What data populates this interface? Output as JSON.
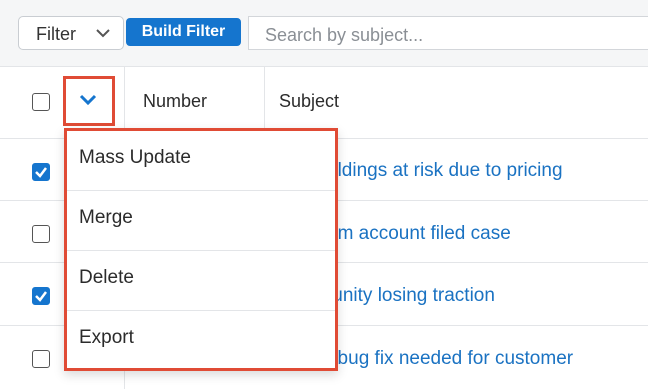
{
  "filter": {
    "label": "Filter",
    "build_filter_label": "Build Filter",
    "search_placeholder": "Search by subject..."
  },
  "table": {
    "columns": [
      "Number",
      "Subject"
    ],
    "rows": [
      {
        "checked": true,
        "subject": "oldings at risk due to pricing"
      },
      {
        "checked": false,
        "subject": "em account filed case"
      },
      {
        "checked": true,
        "subject": "tunity losing traction"
      },
      {
        "checked": false,
        "subject": "t bug fix needed for customer"
      }
    ]
  },
  "actions_menu": {
    "items": [
      "Mass Update",
      "Merge",
      "Delete",
      "Export"
    ]
  },
  "colors": {
    "accent": "#1575ce",
    "highlight_border": "#e04b35",
    "link": "#1a72c2"
  }
}
